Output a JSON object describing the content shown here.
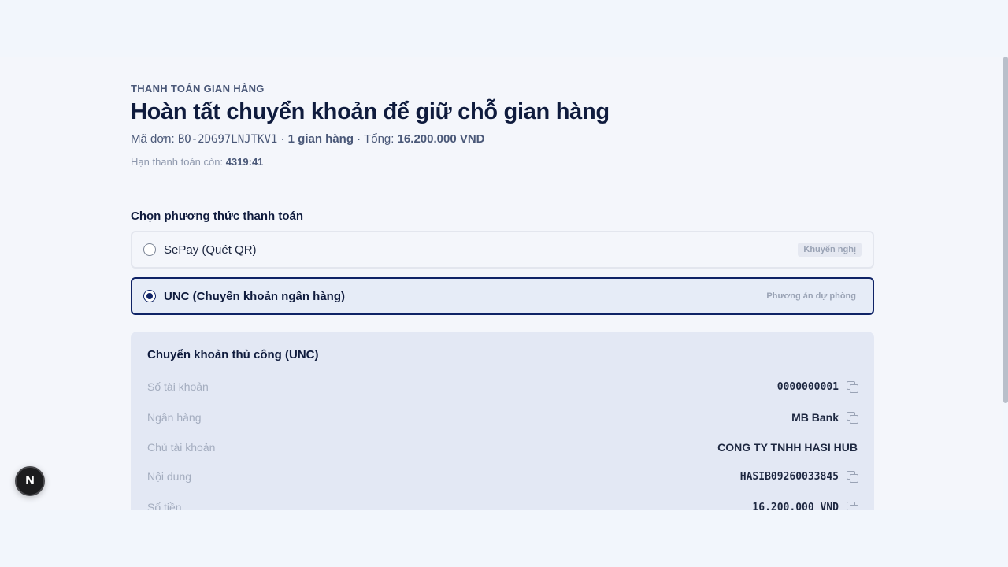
{
  "header": {
    "eyebrow": "THANH TOÁN GIAN HÀNG",
    "title": "Hoàn tất chuyển khoản để giữ chỗ gian hàng",
    "order_label": "Mã đơn: ",
    "order_code": "BO-2DG97LNJTKV1",
    "sep1": " · ",
    "booth_count": "1 gian hàng",
    "sep2": " · Tổng: ",
    "total": "16.200.000 VND",
    "deadline_label": "Hạn thanh toán còn: ",
    "deadline_value": "4319:41"
  },
  "payment": {
    "heading": "Chọn phương thức thanh toán",
    "options": [
      {
        "label": "SePay (Quét QR)",
        "badge": "Khuyến nghị",
        "selected": false
      },
      {
        "label": "UNC (Chuyển khoản ngân hàng)",
        "badge": "Phương án dự phòng",
        "selected": true
      }
    ]
  },
  "transfer": {
    "title": "Chuyển khoản thủ công (UNC)",
    "rows": [
      {
        "label": "Số tài khoản",
        "value": "0000000001"
      },
      {
        "label": "Ngân hàng",
        "value": "MB Bank"
      },
      {
        "label": "Chủ tài khoản",
        "value": "CONG TY TNHH HASI HUB"
      },
      {
        "label": "Nội dung",
        "value": "HASIB09260033845"
      },
      {
        "label": "Số tiền",
        "value": "16.200.000 VND"
      }
    ]
  },
  "fab": {
    "letter": "N"
  },
  "colors": {
    "accent": "#0f2366",
    "panel": "#e3e8f4",
    "background": "#f4f6fb"
  }
}
